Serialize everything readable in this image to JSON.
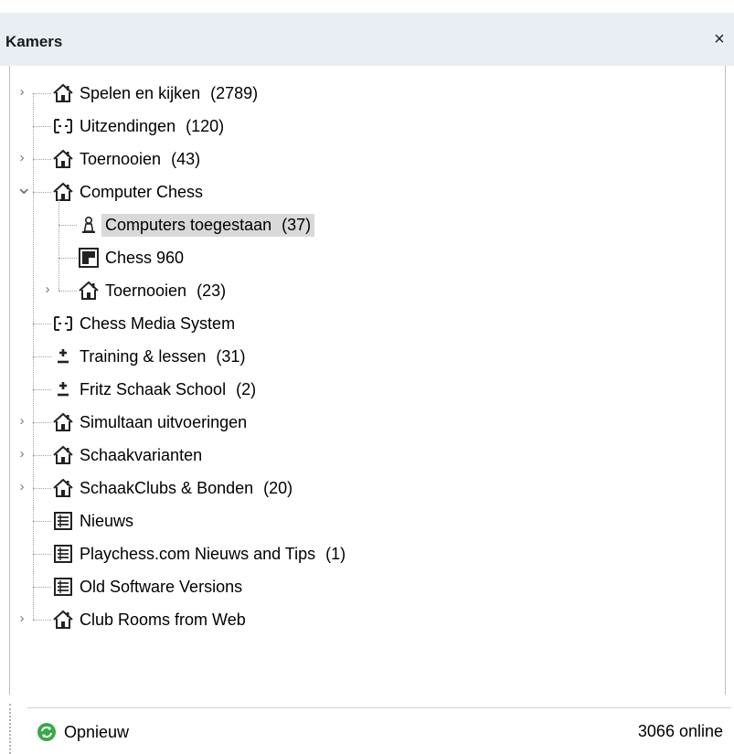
{
  "panel": {
    "title": "Kamers",
    "close_label": "×"
  },
  "tree": [
    {
      "id": "spelen",
      "label": "Spelen en kijken",
      "count": "(2789)",
      "icon": "house-icon",
      "expander": "collapsed"
    },
    {
      "id": "uitzendingen",
      "label": "Uitzendingen",
      "count": "(120)",
      "icon": "broadcast-icon",
      "expander": "none"
    },
    {
      "id": "toernooien",
      "label": "Toernooien",
      "count": "(43)",
      "icon": "house-icon",
      "expander": "collapsed"
    },
    {
      "id": "computer-chess",
      "label": "Computer Chess",
      "count": "",
      "icon": "house-icon",
      "expander": "expanded"
    },
    {
      "id": "computers-toegestaan",
      "label": "Computers toegestaan",
      "count": "(37)",
      "icon": "pawn-icon",
      "expander": "none",
      "selected": true
    },
    {
      "id": "chess960",
      "label": "Chess 960",
      "count": "",
      "icon": "board-icon",
      "expander": "none"
    },
    {
      "id": "toernooien-2",
      "label": "Toernooien",
      "count": "(23)",
      "icon": "house-icon",
      "expander": "collapsed"
    },
    {
      "id": "chess-media",
      "label": "Chess Media System",
      "count": "",
      "icon": "broadcast-icon",
      "expander": "none"
    },
    {
      "id": "training",
      "label": "Training & lessen",
      "count": "(31)",
      "icon": "plusminus-icon",
      "expander": "none"
    },
    {
      "id": "fritz",
      "label": "Fritz Schaak School",
      "count": "(2)",
      "icon": "plusminus-icon",
      "expander": "none"
    },
    {
      "id": "simultaan",
      "label": "Simultaan uitvoeringen",
      "count": "",
      "icon": "house-icon",
      "expander": "collapsed"
    },
    {
      "id": "schaakvarianten",
      "label": "Schaakvarianten",
      "count": "",
      "icon": "house-icon",
      "expander": "collapsed"
    },
    {
      "id": "schaakclubs",
      "label": "SchaakClubs & Bonden",
      "count": "(20)",
      "icon": "house-icon",
      "expander": "collapsed"
    },
    {
      "id": "nieuws",
      "label": "Nieuws",
      "count": "",
      "icon": "list-icon",
      "expander": "none"
    },
    {
      "id": "playchess-nieuws",
      "label": "Playchess.com Nieuws and Tips",
      "count": "(1)",
      "icon": "list-icon",
      "expander": "none"
    },
    {
      "id": "old-software",
      "label": "Old Software Versions",
      "count": "",
      "icon": "list-icon",
      "expander": "none"
    },
    {
      "id": "club-rooms",
      "label": "Club Rooms from Web",
      "count": "",
      "icon": "house-icon",
      "expander": "collapsed"
    }
  ],
  "footer": {
    "refresh_label": "Opnieuw",
    "refresh_icon": "refresh-icon",
    "online_text": "3066 online"
  },
  "colors": {
    "titlebar_bg": "#e9eef4",
    "selection_bg": "#d9d9d9",
    "refresh_green": "#3aa84a"
  }
}
